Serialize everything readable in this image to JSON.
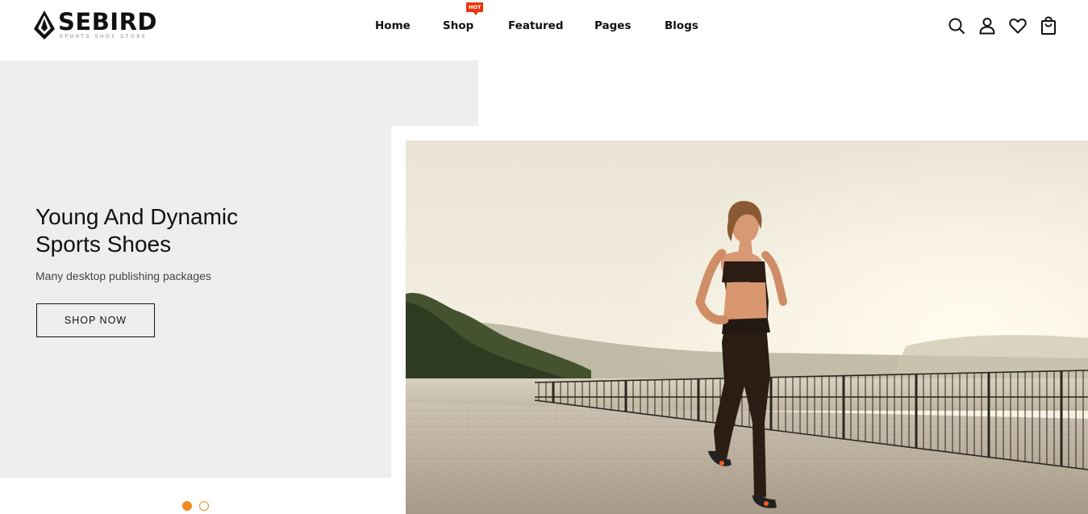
{
  "brand": {
    "name": "SEBIRD",
    "tagline": "SPORTS SHOE STORE"
  },
  "nav": {
    "items": [
      {
        "label": "Home"
      },
      {
        "label": "Shop"
      },
      {
        "label": "Featured"
      },
      {
        "label": "Pages"
      },
      {
        "label": "Blogs"
      }
    ],
    "badge": "HOT"
  },
  "header_icons": [
    "search-icon",
    "user-icon",
    "heart-icon",
    "shopping-bag-icon"
  ],
  "hero": {
    "title_line1": "Young And Dynamic",
    "title_line2": "Sports Shoes",
    "subtitle": "Many desktop publishing packages",
    "cta_label": "SHOP NOW"
  },
  "slider": {
    "slide_count": 2,
    "active_index": 0
  },
  "colors": {
    "accent": "#f0891f",
    "badge": "#e8350e",
    "hero_bg": "#eceef0"
  }
}
